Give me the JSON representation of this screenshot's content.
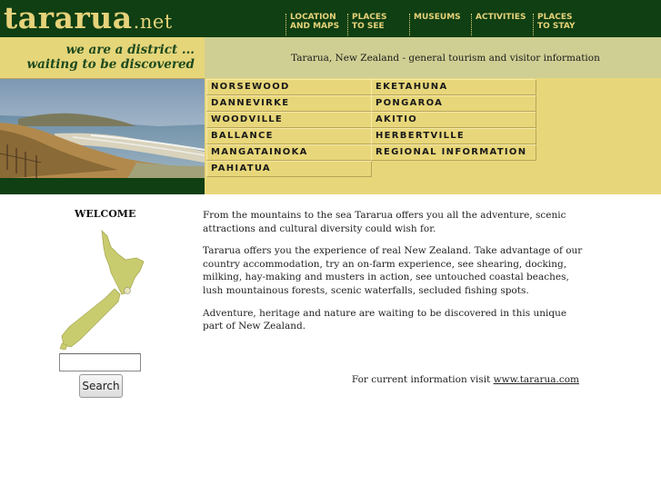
{
  "header": {
    "logo_main": "tararua",
    "logo_tld": ".net",
    "nav": [
      {
        "label": "LOCATION\nAND MAPS"
      },
      {
        "label": "PLACES\nTO SEE"
      },
      {
        "label": "MUSEUMS"
      },
      {
        "label": "ACTIVITIES"
      },
      {
        "label": "PLACES\nTO STAY"
      }
    ]
  },
  "tagline": "we are a district ...\nwaiting to be discovered",
  "info_text": "Tararua, New Zealand - general tourism and visitor information",
  "menu": {
    "left": [
      "NORSEWOOD",
      "DANNEVIRKE",
      "WOODVILLE",
      "BALLANCE",
      "MANGATAINOKA",
      "PAHIATUA"
    ],
    "right": [
      "EKETAHUNA",
      "PONGAROA",
      "AKITIO",
      "HERBERTVILLE",
      "REGIONAL INFORMATION"
    ]
  },
  "sidebar": {
    "welcome": "WELCOME",
    "search_value": "",
    "search_button": "Search"
  },
  "content": {
    "paragraphs": [
      "From the mountains to the sea Tararua offers you all the adventure, scenic attractions and cultural diversity could wish for.",
      "Tararua offers you the experience of real New Zealand. Take advantage of our country accommodation, try an on-farm experience, see shearing, docking, milking, hay-making and musters in action, see untouched coastal beaches, lush mountainous forests, scenic waterfalls, secluded fishing spots.",
      "Adventure, heritage and nature are waiting to be discovered in this unique part of New Zealand."
    ],
    "footer_prefix": "For current information visit ",
    "footer_link": "www.tararua.com"
  },
  "colors": {
    "header_green": "#0f3f12",
    "gold": "#e6d27a",
    "menu_yellow": "#e8d77a",
    "info_band": "#cfcf94"
  }
}
